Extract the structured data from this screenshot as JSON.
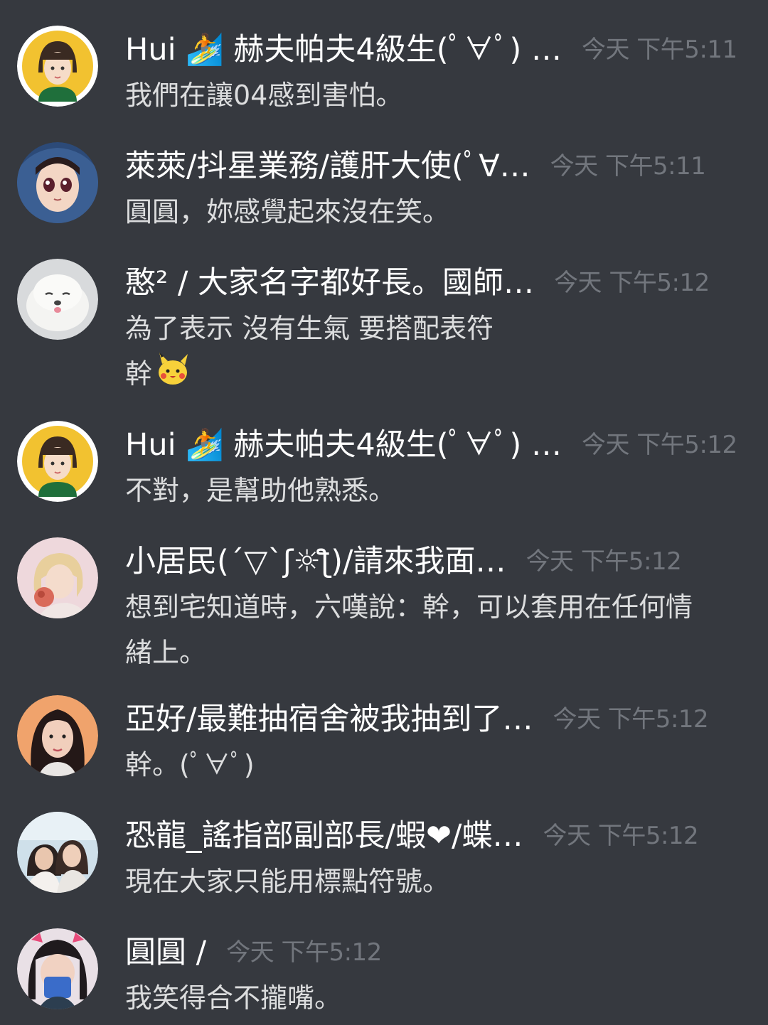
{
  "messages": [
    {
      "author": "Hui 🏄 赫夫帕夫4級生(ﾟ∀ﾟ) … ",
      "timestamp": "今天 下午5:11",
      "lines": [
        "我們在讓04感到害怕。"
      ],
      "avatar": "girl-cartoon-avatar"
    },
    {
      "author": "萊萊/抖星業務/護肝大使(ﾟ∀…",
      "timestamp": "今天 下午5:11",
      "lines": [
        "圓圓，妳感覺起來沒在笑。"
      ],
      "avatar": "anime-character-avatar"
    },
    {
      "author": "憨² / 大家名字都好長。國師…",
      "timestamp": "今天 下午5:12",
      "lines": [
        "為了表示 沒有生氣 要搭配表符",
        "幹"
      ],
      "trailing_emoji": "pikachu-emoji",
      "avatar": "seal-avatar"
    },
    {
      "author": "Hui 🏄 赫夫帕夫4級生(ﾟ∀ﾟ) … ",
      "timestamp": "今天 下午5:12",
      "lines": [
        "不對，是幫助他熟悉。"
      ],
      "avatar": "girl-cartoon-avatar"
    },
    {
      "author": "小居民(´▽`ʃ☼ƪ)/請來我面…",
      "timestamp": "今天 下午5:12",
      "lines": [
        "想到宅知道時，六嘆說：幹，可以套用在任何情",
        "緒上。"
      ],
      "avatar": "blonde-girl-avatar"
    },
    {
      "author": "亞好/最難抽宿舍被我抽到了…",
      "timestamp": "今天 下午5:12",
      "lines": [
        "幹。(ﾟ∀ﾟ)"
      ],
      "avatar": "girl-photo-avatar"
    },
    {
      "author": "恐龍_謠指部副部長/蝦❤/蝶…",
      "timestamp": "今天 下午5:12",
      "lines": [
        "現在大家只能用標點符號。"
      ],
      "avatar": "two-girls-avatar"
    },
    {
      "author": "圓圓 /",
      "timestamp": "今天 下午5:12",
      "lines": [
        "我笑得合不攏嘴。"
      ],
      "avatar": "girl-with-phone-avatar"
    }
  ],
  "colors": {
    "background": "#36393f",
    "author": "#ffffff",
    "timestamp": "#72767d",
    "body_text": "#dcddde"
  }
}
